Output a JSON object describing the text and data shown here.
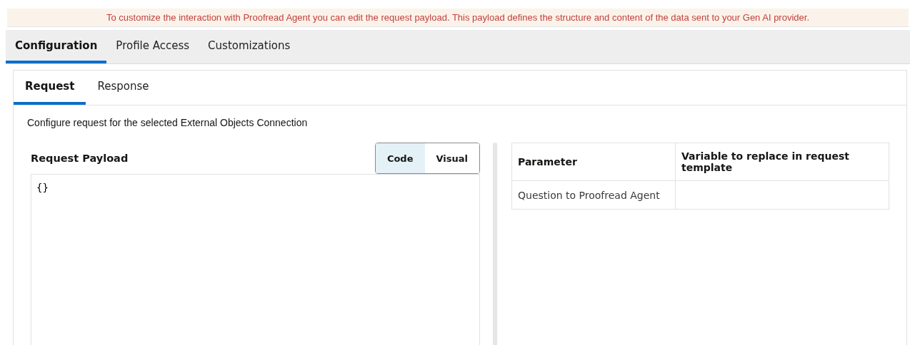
{
  "banner": {
    "text": "To customize the interaction with Proofread Agent you can edit the request payload. This payload defines the structure and content of the data sent to your Gen AI provider."
  },
  "tabs": [
    {
      "label": "Configuration",
      "selected": true
    },
    {
      "label": "Profile Access",
      "selected": false
    },
    {
      "label": "Customizations",
      "selected": false
    }
  ],
  "subtabs": [
    {
      "label": "Request",
      "selected": true
    },
    {
      "label": "Response",
      "selected": false
    }
  ],
  "description": "Configure request for the selected External Objects Connection",
  "payload": {
    "title": "Request Payload",
    "modes": [
      {
        "label": "Code",
        "selected": true
      },
      {
        "label": "Visual",
        "selected": false
      }
    ],
    "value": "{}"
  },
  "table": {
    "columns": [
      "Parameter",
      "Variable to replace in request template"
    ],
    "rows": [
      [
        "Question to Proofread Agent",
        ""
      ]
    ]
  }
}
